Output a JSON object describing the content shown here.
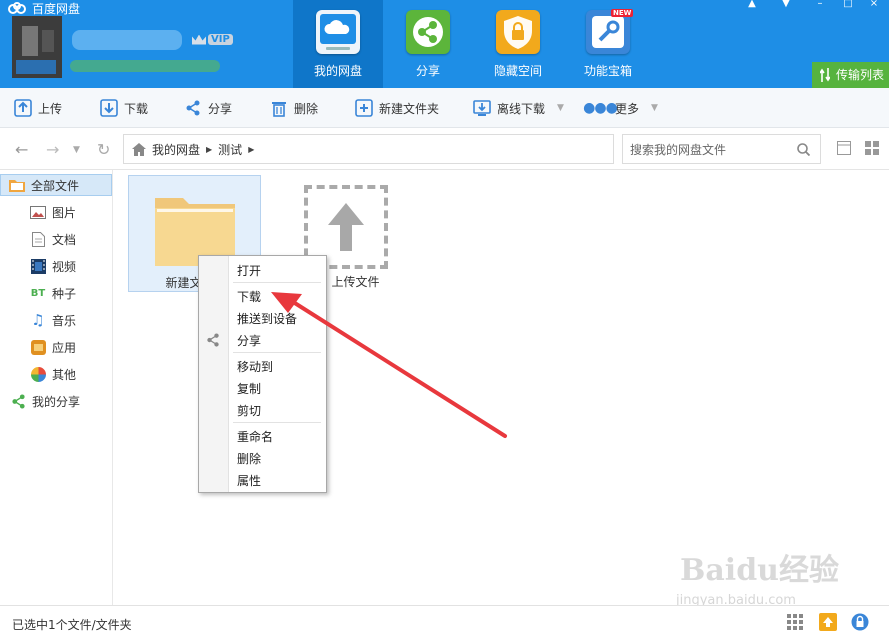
{
  "app": {
    "title": "百度网盘"
  },
  "header": {
    "vip_label": "VIP",
    "nav": [
      {
        "label": "我的网盘",
        "icon": "cloud-icon",
        "active": true
      },
      {
        "label": "分享",
        "icon": "share-icon"
      },
      {
        "label": "隐藏空间",
        "icon": "lock-icon"
      },
      {
        "label": "功能宝箱",
        "icon": "toolbox-icon",
        "badge": "NEW"
      }
    ],
    "transfer_label": "传输列表"
  },
  "toolbar": {
    "upload": "上传",
    "download": "下载",
    "share": "分享",
    "delete": "删除",
    "new_folder": "新建文件夹",
    "offline_download": "离线下载",
    "more": "更多"
  },
  "address": {
    "crumbs": [
      "我的网盘",
      "测试"
    ],
    "search_placeholder": "搜索我的网盘文件"
  },
  "sidebar": {
    "items": [
      {
        "label": "全部文件",
        "icon": "folder-icon",
        "active": true
      },
      {
        "label": "图片",
        "icon": "image-icon"
      },
      {
        "label": "文档",
        "icon": "document-icon"
      },
      {
        "label": "视频",
        "icon": "video-icon"
      },
      {
        "label": "种子",
        "icon": "bt-icon",
        "glyph": "BT"
      },
      {
        "label": "音乐",
        "icon": "music-icon"
      },
      {
        "label": "应用",
        "icon": "app-icon"
      },
      {
        "label": "其他",
        "icon": "other-icon"
      },
      {
        "label": "我的分享",
        "icon": "share-icon"
      }
    ]
  },
  "files": {
    "folder_label": "新建文件夹",
    "upload_label": "上传文件"
  },
  "context_menu": {
    "items": [
      "打开",
      "下载",
      "推送到设备",
      "分享",
      "移动到",
      "复制",
      "剪切",
      "重命名",
      "删除",
      "属性"
    ]
  },
  "status": {
    "text": "已选中1个文件/文件夹"
  },
  "watermark": {
    "main": "Baidu经验",
    "sub": "jingyan.baidu.com"
  },
  "colors": {
    "header": "#1e8ee6",
    "active_tab": "#0f76c9",
    "transfer": "#56b33e",
    "arrow": "#e8383d"
  }
}
